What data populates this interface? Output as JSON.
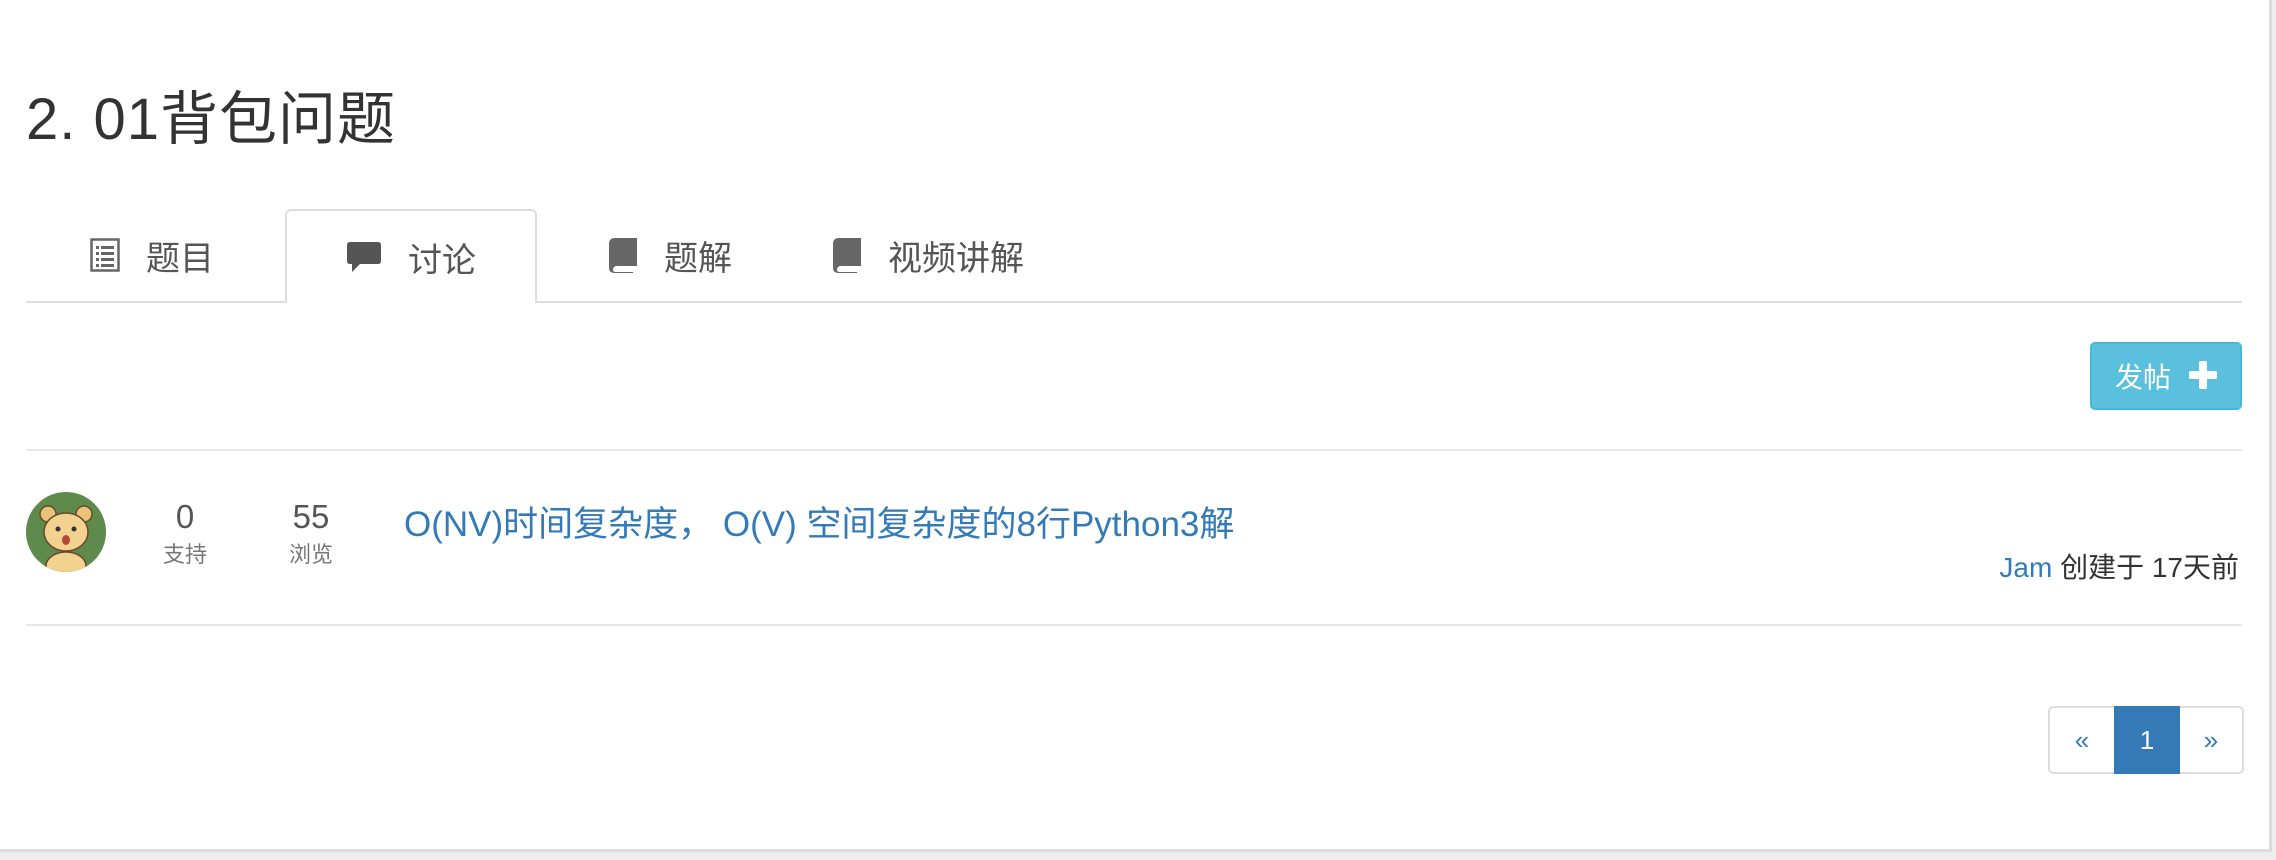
{
  "problem": {
    "title": "2. 01背包问题"
  },
  "tabs": [
    {
      "label": "题目",
      "icon": "list-icon"
    },
    {
      "label": "讨论",
      "icon": "comment-icon",
      "active": true
    },
    {
      "label": "题解",
      "icon": "book-icon"
    },
    {
      "label": "视频讲解",
      "icon": "book-icon"
    }
  ],
  "toolbar": {
    "post_label": "发帖",
    "post_icon": "plus-icon"
  },
  "topics": [
    {
      "votes": "0",
      "votes_label": "支持",
      "views": "55",
      "views_label": "浏览",
      "title": "O(NV)时间复杂度， O(V) 空间复杂度的8行Python3解",
      "author": "Jam",
      "created_text": "创建于 17天前"
    }
  ],
  "pagination": {
    "prev": "«",
    "current": "1",
    "next": "»"
  },
  "colors": {
    "link": "#337ab7",
    "post_button": "#5bc0de",
    "active_page": "#337ab7"
  }
}
